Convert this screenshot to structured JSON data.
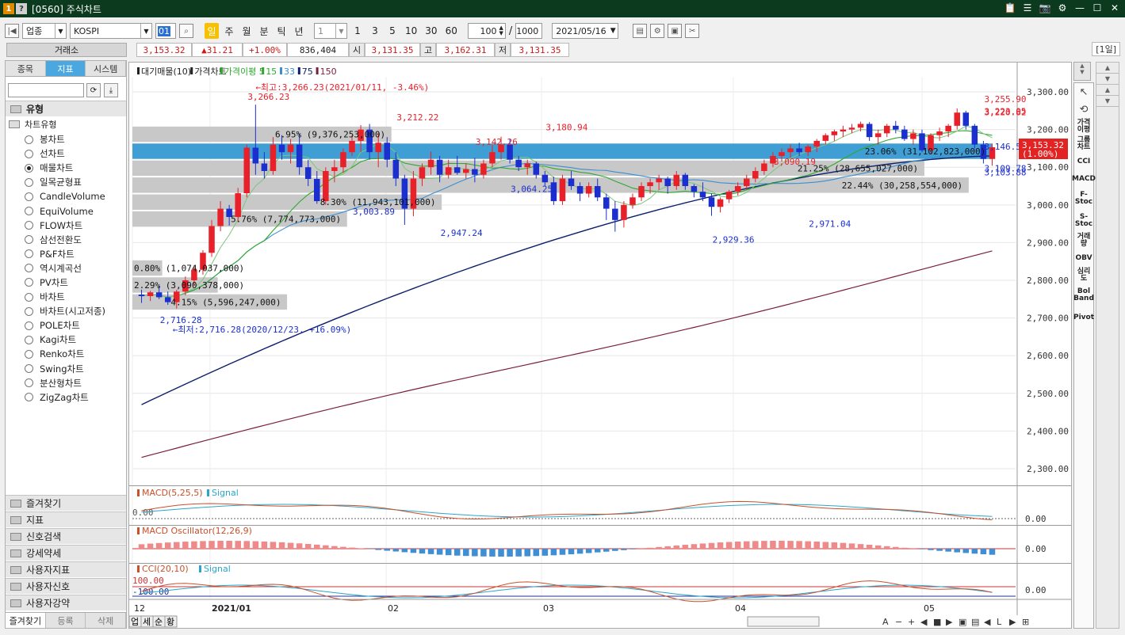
{
  "window": {
    "badges": [
      "1",
      "?"
    ],
    "title": "[0560] 주식차트",
    "controls": [
      "📋",
      "☰",
      "📷",
      "⚙",
      "—",
      "☐",
      "✕"
    ]
  },
  "toolbar": {
    "market_type": "업종",
    "index_name": "KOSPI",
    "code_box": "01",
    "period_buttons": [
      "일",
      "주",
      "월",
      "분",
      "틱",
      "년"
    ],
    "active_period": "일",
    "interval_value": "1",
    "interval_presets": [
      "1",
      "3",
      "5",
      "10",
      "30",
      "60"
    ],
    "count_value": "100",
    "total_value": "1000",
    "date_value": "2021/05/16",
    "separator": "/"
  },
  "quote": {
    "exchange": "거래소",
    "price": "3,153.32",
    "change": "▲31.21",
    "change_pct": "+1.00%",
    "volume": "836,404",
    "open_label": "시",
    "open": "3,131.35",
    "high_label": "고",
    "high": "3,162.31",
    "low_label": "저",
    "low": "3,131.35",
    "period_tag": "[1일]"
  },
  "left_panel": {
    "tabs": [
      "종목",
      "지표",
      "시스템"
    ],
    "active_tab": "지표",
    "section_type": "유형",
    "subheader": "차트유형",
    "chart_types": [
      "봉차트",
      "선차트",
      "매물차트",
      "일목균형표",
      "CandleVolume",
      "EquiVolume",
      "FLOW차트",
      "삼선전환도",
      "P&F차트",
      "역시계곡선",
      "PV차트",
      "바차트",
      "바차트(시고저종)",
      "POLE차트",
      "Kagi차트",
      "Renko차트",
      "Swing차트",
      "분산형차트",
      "ZigZag차트"
    ],
    "selected_type": "매물차트",
    "sections": [
      "즐겨찾기",
      "지표",
      "신호검색",
      "강세약세",
      "사용자지표",
      "사용자신호",
      "사용자강약"
    ],
    "bottom_tabs": [
      "즐겨찾기",
      "등록",
      "삭제"
    ]
  },
  "right_tools": {
    "labels": [
      "가격이평",
      "그룹차트",
      "CCI",
      "MACD",
      "F-Stoc",
      "S-Stoc",
      "거래량",
      "OBV",
      "심리도",
      "Bol Band",
      "Pivot"
    ]
  },
  "colors": {
    "up": "#e8202a",
    "down": "#1b2fcf",
    "ma5": "#2fa82f",
    "ma15": "#2fa82f",
    "ma33": "#3b8fd1",
    "ma75": "#0d1f6b",
    "ma150": "#7a1f3a",
    "volume_band": "#c8c8c8",
    "volume_band_max": "#3f9fd4"
  },
  "chart_data": [
    {
      "type": "candlestick",
      "legend": [
        "대기매물(10)",
        "가격차트",
        "가격이평 5",
        "15",
        "33",
        "75",
        "150"
      ],
      "y_ticks": [
        "3,300.00",
        "3,200.00",
        "3,100.00",
        "3,000.00",
        "2,900.00",
        "2,800.00",
        "2,700.00",
        "2,600.00",
        "2,500.00",
        "2,400.00",
        "2,300.00"
      ],
      "ylim": [
        2260,
        3340
      ],
      "x_labels": [
        "12",
        "2021/01",
        "02",
        "03",
        "04",
        "05"
      ],
      "last_price_label": "3,153.32",
      "last_change_label": "(1.00%)",
      "candles": [
        [
          2762,
          2775,
          2740,
          2758
        ],
        [
          2758,
          2772,
          2745,
          2768
        ],
        [
          2768,
          2785,
          2750,
          2755
        ],
        [
          2755,
          2770,
          2735,
          2742
        ],
        [
          2742,
          2775,
          2725,
          2770
        ],
        [
          2770,
          2810,
          2760,
          2800
        ],
        [
          2800,
          2840,
          2785,
          2828
        ],
        [
          2828,
          2880,
          2815,
          2873
        ],
        [
          2873,
          2960,
          2862,
          2944
        ],
        [
          2944,
          3010,
          2930,
          2990
        ],
        [
          2990,
          3000,
          2945,
          2968
        ],
        [
          2968,
          3045,
          2955,
          3031
        ],
        [
          3031,
          3160,
          3020,
          3152
        ],
        [
          3152,
          3266,
          3080,
          3110
        ],
        [
          3110,
          3140,
          3070,
          3090
        ],
        [
          3090,
          3180,
          3080,
          3160
        ],
        [
          3160,
          3185,
          3120,
          3140
        ],
        [
          3140,
          3175,
          3110,
          3160
        ],
        [
          3160,
          3190,
          3080,
          3100
        ],
        [
          3100,
          3120,
          3050,
          3069
        ],
        [
          3069,
          3090,
          3003,
          3010
        ],
        [
          3010,
          3100,
          3000,
          3090
        ],
        [
          3090,
          3120,
          3060,
          3100
        ],
        [
          3100,
          3150,
          3085,
          3140
        ],
        [
          3140,
          3185,
          3130,
          3170
        ],
        [
          3170,
          3212,
          3140,
          3200
        ],
        [
          3200,
          3215,
          3120,
          3140
        ],
        [
          3140,
          3190,
          3100,
          3165
        ],
        [
          3165,
          3180,
          3100,
          3120
        ],
        [
          3120,
          3140,
          3050,
          3070
        ],
        [
          3070,
          3080,
          2947,
          2990
        ],
        [
          2990,
          3090,
          2970,
          3070
        ],
        [
          3070,
          3110,
          3050,
          3100
        ],
        [
          3100,
          3142,
          3080,
          3120
        ],
        [
          3120,
          3130,
          3060,
          3080
        ],
        [
          3080,
          3120,
          3070,
          3100
        ],
        [
          3100,
          3130,
          3080,
          3085
        ],
        [
          3085,
          3110,
          3070,
          3095
        ],
        [
          3095,
          3125,
          3060,
          3080
        ],
        [
          3080,
          3120,
          3070,
          3110
        ],
        [
          3110,
          3160,
          3100,
          3140
        ],
        [
          3140,
          3181,
          3120,
          3160
        ],
        [
          3160,
          3175,
          3110,
          3120
        ],
        [
          3120,
          3130,
          3090,
          3100
        ],
        [
          3100,
          3120,
          3080,
          3110
        ],
        [
          3110,
          3115,
          3070,
          3080
        ],
        [
          3080,
          3090,
          3050,
          3060
        ],
        [
          3060,
          3075,
          3000,
          3010
        ],
        [
          3010,
          3080,
          3000,
          3070
        ],
        [
          3070,
          3090,
          3040,
          3050
        ],
        [
          3050,
          3060,
          3010,
          3030
        ],
        [
          3030,
          3060,
          3020,
          3050
        ],
        [
          3050,
          3070,
          3010,
          3020
        ],
        [
          3020,
          3030,
          2960,
          2990
        ],
        [
          2990,
          3010,
          2929,
          2960
        ],
        [
          2960,
          3010,
          2940,
          3000
        ],
        [
          3000,
          3030,
          2990,
          3020
        ],
        [
          3020,
          3060,
          3010,
          3050
        ],
        [
          3050,
          3070,
          3030,
          3060
        ],
        [
          3060,
          3080,
          3040,
          3070
        ],
        [
          3070,
          3075,
          3030,
          3050
        ],
        [
          3050,
          3090,
          3040,
          3080
        ],
        [
          3080,
          3085,
          3040,
          3050
        ],
        [
          3050,
          3055,
          3020,
          3035
        ],
        [
          3035,
          3060,
          3010,
          3020
        ],
        [
          3020,
          3030,
          2971,
          2995
        ],
        [
          2995,
          3020,
          2980,
          3015
        ],
        [
          3015,
          3040,
          3005,
          3035
        ],
        [
          3035,
          3060,
          3025,
          3050
        ],
        [
          3050,
          3080,
          3040,
          3070
        ],
        [
          3070,
          3100,
          3060,
          3090
        ],
        [
          3090,
          3120,
          3080,
          3110
        ],
        [
          3110,
          3140,
          3100,
          3130
        ],
        [
          3130,
          3150,
          3115,
          3140
        ],
        [
          3140,
          3160,
          3125,
          3150
        ],
        [
          3150,
          3165,
          3130,
          3140
        ],
        [
          3140,
          3160,
          3130,
          3155
        ],
        [
          3155,
          3175,
          3140,
          3170
        ],
        [
          3170,
          3190,
          3160,
          3185
        ],
        [
          3185,
          3200,
          3170,
          3195
        ],
        [
          3195,
          3210,
          3180,
          3200
        ],
        [
          3200,
          3215,
          3190,
          3205
        ],
        [
          3205,
          3221,
          3195,
          3215
        ],
        [
          3215,
          3220,
          3170,
          3180
        ],
        [
          3180,
          3200,
          3160,
          3190
        ],
        [
          3190,
          3215,
          3180,
          3210
        ],
        [
          3210,
          3223,
          3190,
          3200
        ],
        [
          3200,
          3210,
          3170,
          3175
        ],
        [
          3175,
          3200,
          3160,
          3190
        ],
        [
          3190,
          3200,
          3140,
          3145
        ],
        [
          3145,
          3190,
          3135,
          3185
        ],
        [
          3185,
          3205,
          3170,
          3195
        ],
        [
          3195,
          3215,
          3180,
          3210
        ],
        [
          3210,
          3256,
          3200,
          3245
        ],
        [
          3245,
          3250,
          3200,
          3210
        ],
        [
          3210,
          3215,
          3150,
          3160
        ],
        [
          3160,
          3170,
          3110,
          3122
        ],
        [
          3122,
          3163,
          3104,
          3153
        ]
      ],
      "volume_profile": [
        {
          "price_from": 2720,
          "price_to": 2765,
          "label": "4.15% (5,596,247,000)",
          "pct": 4.15
        },
        {
          "price_from": 2765,
          "price_to": 2810,
          "label": "2.29% (3,090,378,000)",
          "pct": 2.29
        },
        {
          "price_from": 2810,
          "price_to": 2855,
          "label": "0.80% (1,074,037,000)",
          "pct": 0.8
        },
        {
          "price_from": 2940,
          "price_to": 2985,
          "label": "5.76% (7,774,773,000)",
          "pct": 5.76
        },
        {
          "price_from": 2985,
          "price_to": 3030,
          "label": "8.30% (11,943,101,000)",
          "pct": 8.3
        },
        {
          "price_from": 3030,
          "price_to": 3075,
          "label": "22.44% (30,258,554,000)",
          "pct": 22.44
        },
        {
          "price_from": 3075,
          "price_to": 3120,
          "label": "21.25% (28,655,027,000)",
          "pct": 21.25
        },
        {
          "price_from": 3120,
          "price_to": 3165,
          "label": "23.06% (31,102,823,000)",
          "pct": 23.06
        },
        {
          "price_from": 3165,
          "price_to": 3210,
          "label": "6.95% (9,376,253,000)",
          "pct": 6.95
        }
      ],
      "annotations": {
        "high": "←최고:3,266.23(2021/01/11, -3.46%)",
        "low": "←최저:2,716.28(2020/12/23, +16.09%)",
        "points": [
          {
            "text": "3,266.23",
            "color": "up"
          },
          {
            "text": "3,212.22",
            "color": "up"
          },
          {
            "text": "3,142.26",
            "color": "up"
          },
          {
            "text": "3,180.94",
            "color": "up"
          },
          {
            "text": "3,090.19",
            "color": "up"
          },
          {
            "text": "3,220.82",
            "color": "up"
          },
          {
            "text": "3,223.05",
            "color": "up"
          },
          {
            "text": "3,255.90",
            "color": "up"
          },
          {
            "text": "2,716.28",
            "color": "down"
          },
          {
            "text": "3,003.89",
            "color": "down"
          },
          {
            "text": "2,947.24",
            "color": "down"
          },
          {
            "text": "3,064.25",
            "color": "down"
          },
          {
            "text": "2,929.36",
            "color": "down"
          },
          {
            "text": "2,971.04",
            "color": "down"
          },
          {
            "text": "3,146.54",
            "color": "down"
          },
          {
            "text": "3,109.78",
            "color": "down"
          },
          {
            "text": "3,103.88",
            "color": "down"
          }
        ]
      }
    },
    {
      "type": "line",
      "title": "MACD(5,25,5)",
      "legend": [
        "MACD(5,25,5)",
        "Signal"
      ],
      "left_label": "0.00",
      "right_label": "0.00"
    },
    {
      "type": "bar",
      "title": "MACD Oscillator(12,26,9)",
      "legend": [
        "MACD Oscillator(12,26,9)"
      ],
      "right_label": "0.00"
    },
    {
      "type": "area",
      "title": "CCI(20,10)",
      "legend": [
        "CCI(20,10)",
        "Signal"
      ],
      "left_labels": [
        "100.00",
        "-100.00"
      ],
      "right_label": "0.00"
    }
  ],
  "bottom_bar": {
    "tabs": [
      "업",
      "세",
      "순",
      "황"
    ]
  }
}
